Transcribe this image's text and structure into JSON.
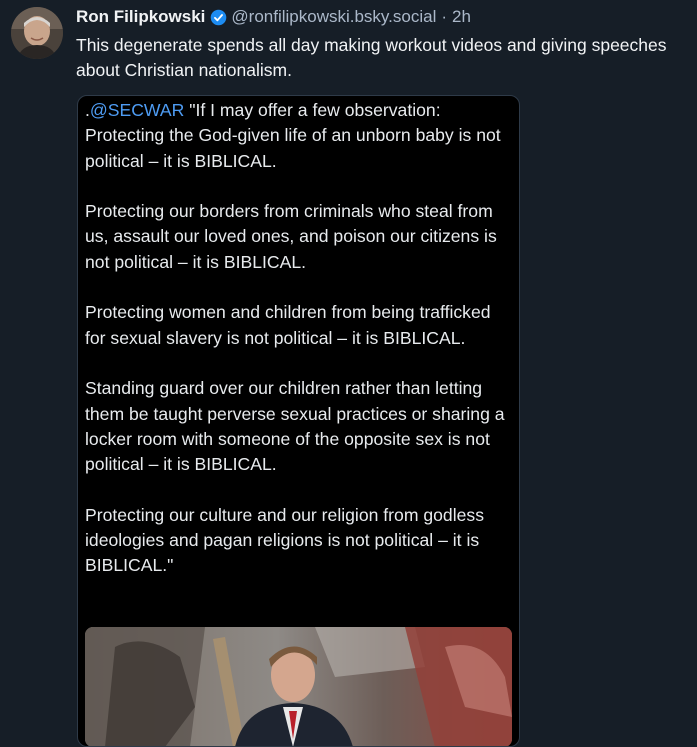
{
  "post": {
    "author_name": "Ron Filipkowski",
    "handle": "@ronfilipkowski.bsky.social",
    "separator": "·",
    "time": "2h",
    "text": "This degenerate spends all day making workout videos and giving speeches about Christian nationalism."
  },
  "quote": {
    "prefix": ".",
    "mention": "@SECWAR",
    "paragraphs": [
      " \"If I may offer a few observation: Protecting the God-given life of an unborn baby is not political – it is BIBLICAL.",
      "Protecting our borders from criminals who steal from us, assault our loved ones, and poison our citizens is not political – it is BIBLICAL.",
      "Protecting women and children from being trafficked for sexual slavery is not political – it is BIBLICAL.",
      "Standing guard over our children rather than letting them be taught perverse sexual practices or sharing a locker room with someone of the opposite sex is not political – it is BIBLICAL.",
      "Protecting our culture and our religion from godless ideologies and pagan religions is not political – it is BIBLICAL.\""
    ]
  },
  "icons": {
    "verified": "verified-badge-icon"
  },
  "colors": {
    "background": "#161e27",
    "quote_background": "#000000",
    "mention": "#4e9cf3",
    "verified": "#1d8cf2",
    "secondary_text": "#abb8c9"
  }
}
